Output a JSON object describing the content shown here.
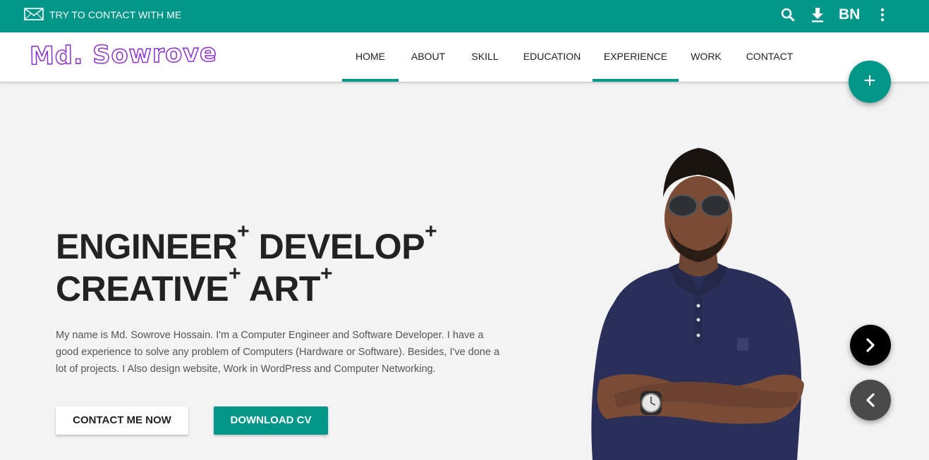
{
  "topbar": {
    "contact_text": "TRY TO CONTACT WITH ME",
    "language_label": "BN",
    "background_color": "#009688"
  },
  "navbar": {
    "logo_text": "Md. Sowrove",
    "items": [
      {
        "label": "HOME",
        "active": true
      },
      {
        "label": "ABOUT",
        "active": false
      },
      {
        "label": "SKILL",
        "active": false
      },
      {
        "label": "EDUCATION",
        "active": false
      },
      {
        "label": "EXPERIENCE",
        "active": true
      },
      {
        "label": "WORK",
        "active": false
      },
      {
        "label": "CONTACT",
        "active": false
      }
    ]
  },
  "hero": {
    "line1_word1": "ENGINEER",
    "line1_word2": "DEVELOP",
    "line2_word1": "CREATIVE",
    "line2_word2": "ART",
    "plus_mark": "+",
    "intro": "My name is Md. Sowrove Hossain. I'm a Computer Engineer and Software Developer. I have a good experience to solve any problem of Computers (Hardware or Software). Besides, I've done a lot of projects. I Also design website, Work in WordPress and Computer Networking.",
    "contact_button": "CONTACT ME NOW",
    "download_button": "DOWNLOAD CV"
  },
  "fab": {
    "add_symbol": "+"
  },
  "icons": {
    "mail": "mail-icon",
    "search": "search-icon",
    "download": "download-icon",
    "more": "more-vert-icon",
    "next": "chevron-right-icon",
    "prev": "chevron-left-icon"
  },
  "colors": {
    "accent": "#009688",
    "logo": "#8b2fd3"
  }
}
